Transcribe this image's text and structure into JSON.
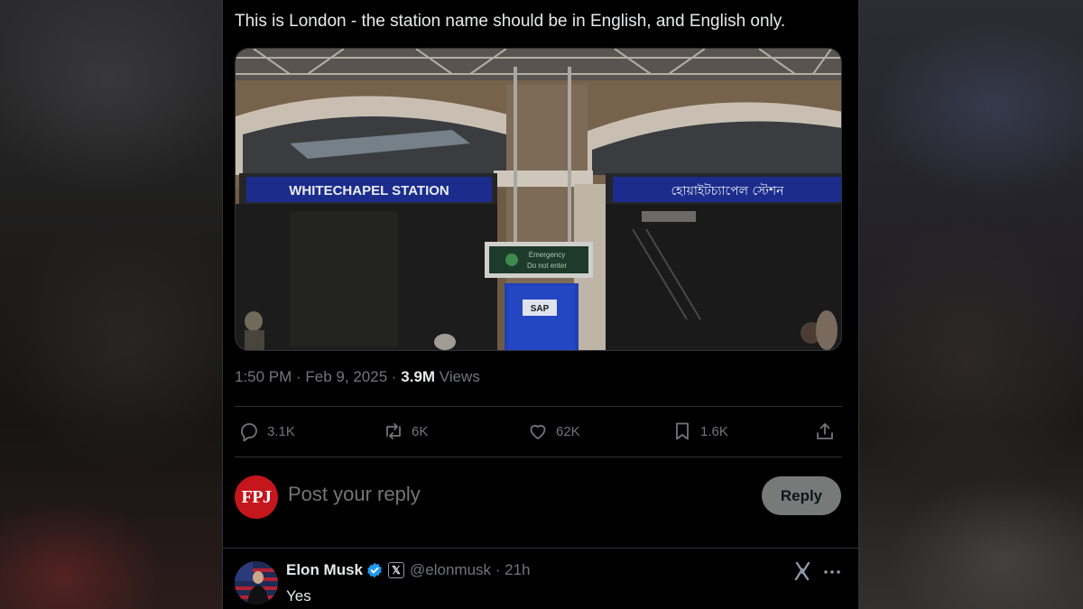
{
  "tweet": {
    "text": "This is London - the station name should be in English, and English only.",
    "media": {
      "sign_english": "WHITECHAPEL STATION",
      "sign_bengali": "হোয়াইটচ্যাপেল স্টেশন",
      "emergency_line1": "Emergency",
      "emergency_line2": "Do not enter",
      "box_label": "SAP"
    },
    "meta": {
      "timestamp": "1:50 PM · Feb 9, 2025 · ",
      "views_count": "3.9M",
      "views_label": " Views"
    },
    "actions": {
      "replies": "3.1K",
      "reposts": "6K",
      "likes": "62K",
      "bookmarks": "1.6K"
    },
    "icons": [
      "reply-icon",
      "repost-icon",
      "like-icon",
      "bookmark-icon",
      "share-icon"
    ]
  },
  "compose": {
    "avatar_text": "FPJ",
    "placeholder": "Post your reply",
    "button_label": "Reply"
  },
  "reply": {
    "name": "Elon Musk",
    "badge_text": "𝕏",
    "handle_time": "@elonmusk · 21h",
    "text": "Yes"
  },
  "colors": {
    "background": "#000000",
    "text": "#e7e9ea",
    "muted": "#71767b",
    "border": "#2f3336",
    "verified": "#1d9bf0",
    "fpj_red": "#c4161c",
    "sign_blue": "#1b2c8c"
  }
}
